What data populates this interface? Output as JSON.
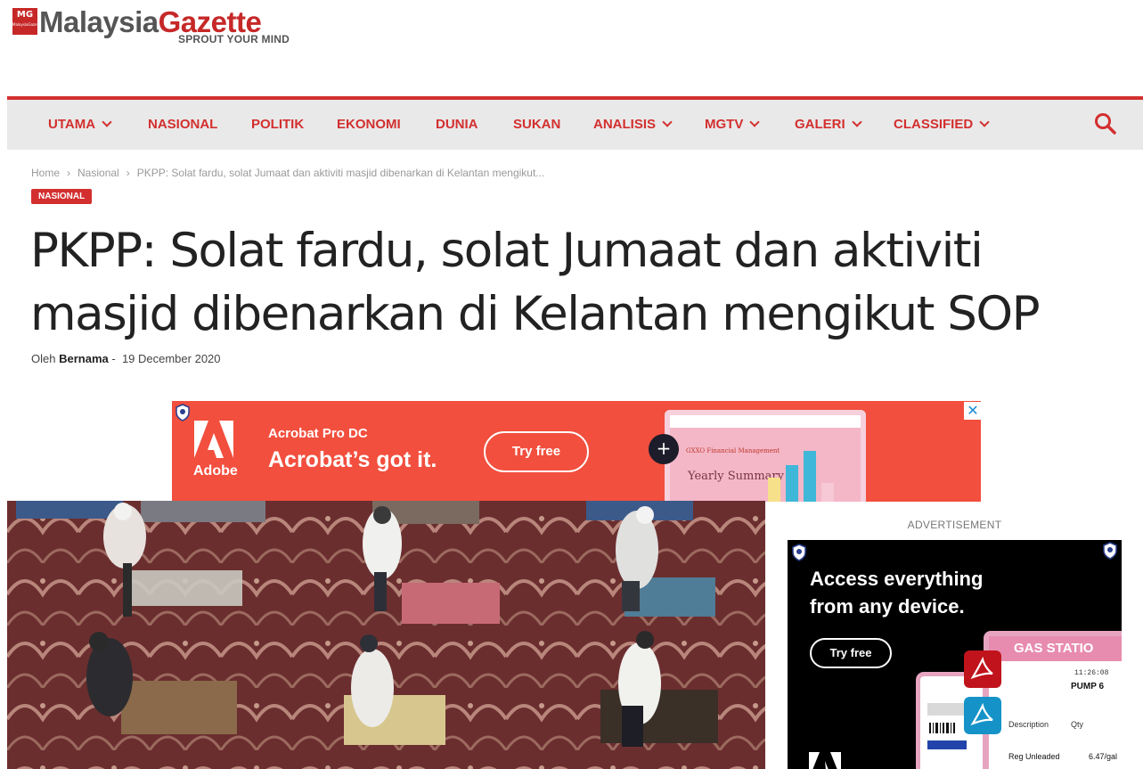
{
  "logo": {
    "badge": "MG",
    "badge_small": "MalaysiaGazette",
    "word_part1": "Malaysia",
    "word_part2": "Gazette",
    "tagline": "SPROUT YOUR MIND"
  },
  "nav": {
    "items": [
      {
        "label": "UTAMA",
        "dropdown": true
      },
      {
        "label": "NASIONAL",
        "dropdown": false
      },
      {
        "label": "POLITIK",
        "dropdown": false
      },
      {
        "label": "EKONOMI",
        "dropdown": false
      },
      {
        "label": "DUNIA",
        "dropdown": false
      },
      {
        "label": "SUKAN",
        "dropdown": false
      },
      {
        "label": "ANALISIS",
        "dropdown": true
      },
      {
        "label": "MGTV",
        "dropdown": true
      },
      {
        "label": "GALERI",
        "dropdown": true
      },
      {
        "label": "CLASSIFIED",
        "dropdown": true
      }
    ],
    "search_icon": "search-icon"
  },
  "breadcrumb": {
    "home": "Home",
    "section": "Nasional",
    "current": "PKPP: Solat fardu, solat Jumaat dan aktiviti masjid dibenarkan di Kelantan mengikut..."
  },
  "article": {
    "category": "NASIONAL",
    "title": "PKPP: Solat fardu, solat Jumaat dan aktiviti masjid dibenarkan di Kelantan mengikut SOP",
    "byline_prefix": "Oleh",
    "author": "Bernama",
    "byline_sep": "-",
    "date": "19 December 2020"
  },
  "ad_top": {
    "brand": "Adobe",
    "product": "Acrobat Pro DC",
    "headline": "Acrobat’s got it.",
    "cta": "Try free",
    "plus": "+",
    "close": "✕",
    "doc_header": "GXXO Financial Management",
    "doc_title": "Yearly Summary",
    "colors": {
      "background": "#f24f3e"
    }
  },
  "sidebar": {
    "label": "ADVERTISEMENT",
    "ad": {
      "headline": "Access everything from any device.",
      "cta": "Try free",
      "card_title": "GAS STATIO",
      "card_time": "11:26:08",
      "card_pump": "PUMP 6",
      "card_desc": "Description",
      "card_qty": "Qty",
      "card_item": "Reg Unleaded",
      "card_price": "6.47/gal"
    }
  }
}
